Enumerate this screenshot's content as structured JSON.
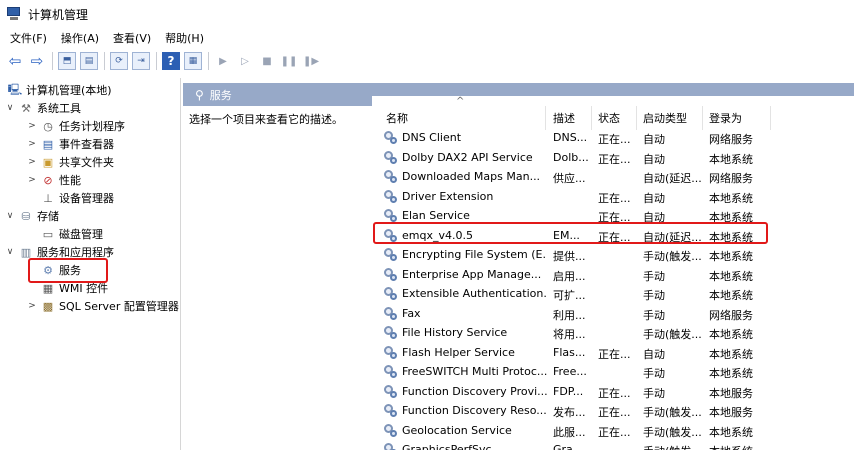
{
  "window": {
    "title": "计算机管理"
  },
  "menu": [
    "文件(F)",
    "操作(A)",
    "查看(V)",
    "帮助(H)"
  ],
  "toolbar": {
    "back": "⇦",
    "forward": "⇨",
    "up": "⬒",
    "show_hide": "▤",
    "refresh": "⟳",
    "export": "⇥",
    "help": "?",
    "props": "▦",
    "start": "▶",
    "start2": "▷",
    "stop": "■",
    "pause": "❚❚",
    "resume": "❚▶"
  },
  "tree": {
    "root": "计算机管理(本地)",
    "system_tools": "系统工具",
    "task_scheduler": "任务计划程序",
    "event_viewer": "事件查看器",
    "shared_folders": "共享文件夹",
    "performance": "性能",
    "device_manager": "设备管理器",
    "storage": "存储",
    "disk_management": "磁盘管理",
    "services_apps": "服务和应用程序",
    "services": "服务",
    "wmi": "WMI 控件",
    "sql": "SQL Server 配置管理器"
  },
  "panel": {
    "title": "服务",
    "description": "选择一个项目来查看它的描述。"
  },
  "columns": {
    "name": "名称",
    "desc": "描述",
    "status": "状态",
    "startup": "启动类型",
    "logon": "登录为",
    "sort_indicator": "^"
  },
  "services": [
    {
      "name": "DNS Client",
      "desc": "DNS...",
      "status": "正在...",
      "startup": "自动",
      "logon": "网络服务"
    },
    {
      "name": "Dolby DAX2 API Service",
      "desc": "Dolb...",
      "status": "正在...",
      "startup": "自动",
      "logon": "本地系统"
    },
    {
      "name": "Downloaded Maps Man...",
      "desc": "供应...",
      "status": "",
      "startup": "自动(延迟...",
      "logon": "网络服务"
    },
    {
      "name": "Driver Extension",
      "desc": "",
      "status": "正在...",
      "startup": "自动",
      "logon": "本地系统"
    },
    {
      "name": "Elan Service",
      "desc": "",
      "status": "正在...",
      "startup": "自动",
      "logon": "本地系统"
    },
    {
      "name": "emqx_v4.0.5",
      "desc": "EM...",
      "status": "正在...",
      "startup": "自动(延迟...",
      "logon": "本地系统"
    },
    {
      "name": "Encrypting File System (E...",
      "desc": "提供...",
      "status": "",
      "startup": "手动(触发...",
      "logon": "本地系统"
    },
    {
      "name": "Enterprise App Manage...",
      "desc": "启用...",
      "status": "",
      "startup": "手动",
      "logon": "本地系统"
    },
    {
      "name": "Extensible Authentication...",
      "desc": "可扩...",
      "status": "",
      "startup": "手动",
      "logon": "本地系统"
    },
    {
      "name": "Fax",
      "desc": "利用...",
      "status": "",
      "startup": "手动",
      "logon": "网络服务"
    },
    {
      "name": "File History Service",
      "desc": "将用...",
      "status": "",
      "startup": "手动(触发...",
      "logon": "本地系统"
    },
    {
      "name": "Flash Helper Service",
      "desc": "Flas...",
      "status": "正在...",
      "startup": "自动",
      "logon": "本地系统"
    },
    {
      "name": "FreeSWITCH Multi Protoc...",
      "desc": "Free...",
      "status": "",
      "startup": "手动",
      "logon": "本地系统"
    },
    {
      "name": "Function Discovery Provi...",
      "desc": "FDP...",
      "status": "正在...",
      "startup": "手动",
      "logon": "本地服务"
    },
    {
      "name": "Function Discovery Reso...",
      "desc": "发布...",
      "status": "正在...",
      "startup": "手动(触发...",
      "logon": "本地服务"
    },
    {
      "name": "Geolocation Service",
      "desc": "此服...",
      "status": "正在...",
      "startup": "手动(触发...",
      "logon": "本地系统"
    },
    {
      "name": "GraphicsPerfSvc",
      "desc": "Gra...",
      "status": "",
      "startup": "手动(触发...",
      "logon": "本地系统"
    }
  ],
  "highlight_color": "#e11919"
}
